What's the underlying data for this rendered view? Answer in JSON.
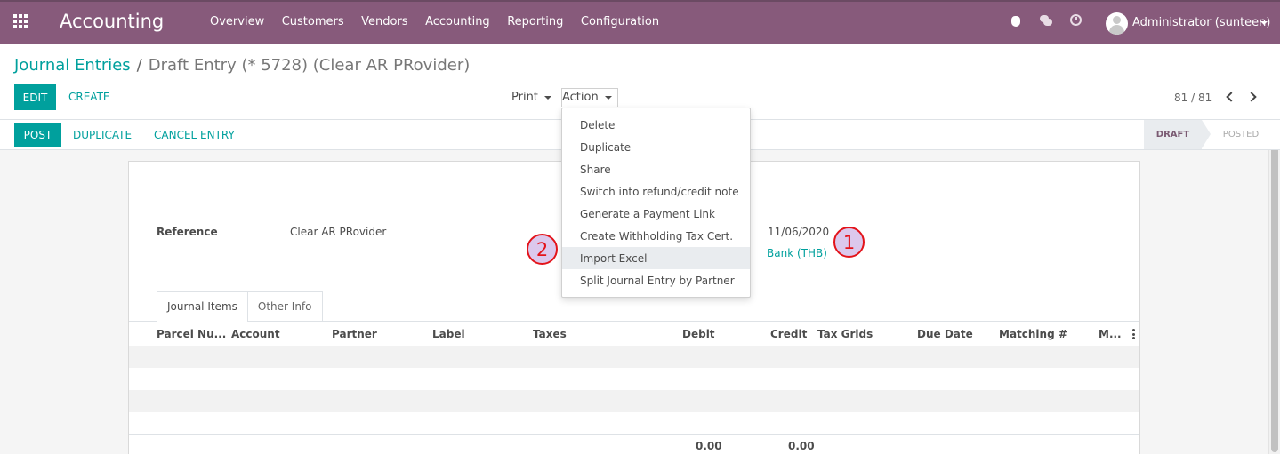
{
  "navbar": {
    "app_title": "Accounting",
    "menu": [
      "Overview",
      "Customers",
      "Vendors",
      "Accounting",
      "Reporting",
      "Configuration"
    ],
    "user": "Administrator (sunteen)",
    "icons": [
      "bug-icon",
      "chat-icon",
      "clock-icon"
    ]
  },
  "breadcrumb": {
    "parent": "Journal Entries",
    "separator": "/",
    "current": "Draft Entry (* 5728) (Clear AR PRovider)"
  },
  "control": {
    "edit": "EDIT",
    "create": "CREATE",
    "print": "Print",
    "action": "Action",
    "pager": "81 / 81"
  },
  "statusbar": {
    "post": "POST",
    "duplicate": "DUPLICATE",
    "cancel": "CANCEL ENTRY",
    "stages": [
      "DRAFT",
      "POSTED"
    ],
    "active_stage": "DRAFT"
  },
  "form": {
    "reference_label": "Reference",
    "reference_value": "Clear AR PRovider",
    "date_value": "11/06/2020",
    "journal_value": "Bank (THB)"
  },
  "tabs": [
    "Journal Items",
    "Other Info"
  ],
  "table": {
    "columns": [
      "Parcel Nu...",
      "Account",
      "Partner",
      "Label",
      "Taxes",
      "Debit",
      "Credit",
      "Tax Grids",
      "Due Date",
      "Matching #",
      "M..."
    ],
    "total_debit": "0.00",
    "total_credit": "0.00"
  },
  "action_menu": {
    "items": [
      "Delete",
      "Duplicate",
      "Share",
      "Switch into refund/credit note",
      "Generate a Payment Link",
      "Create Withholding Tax Cert.",
      "Import Excel",
      "Split Journal Entry by Partner"
    ],
    "highlighted": "Import Excel"
  },
  "markers": [
    "1",
    "2"
  ],
  "colors": {
    "navbar": "#875a7b",
    "primary": "#00a09d",
    "marker_border": "#e3131a",
    "marker_fill": "#dcc8ec"
  }
}
